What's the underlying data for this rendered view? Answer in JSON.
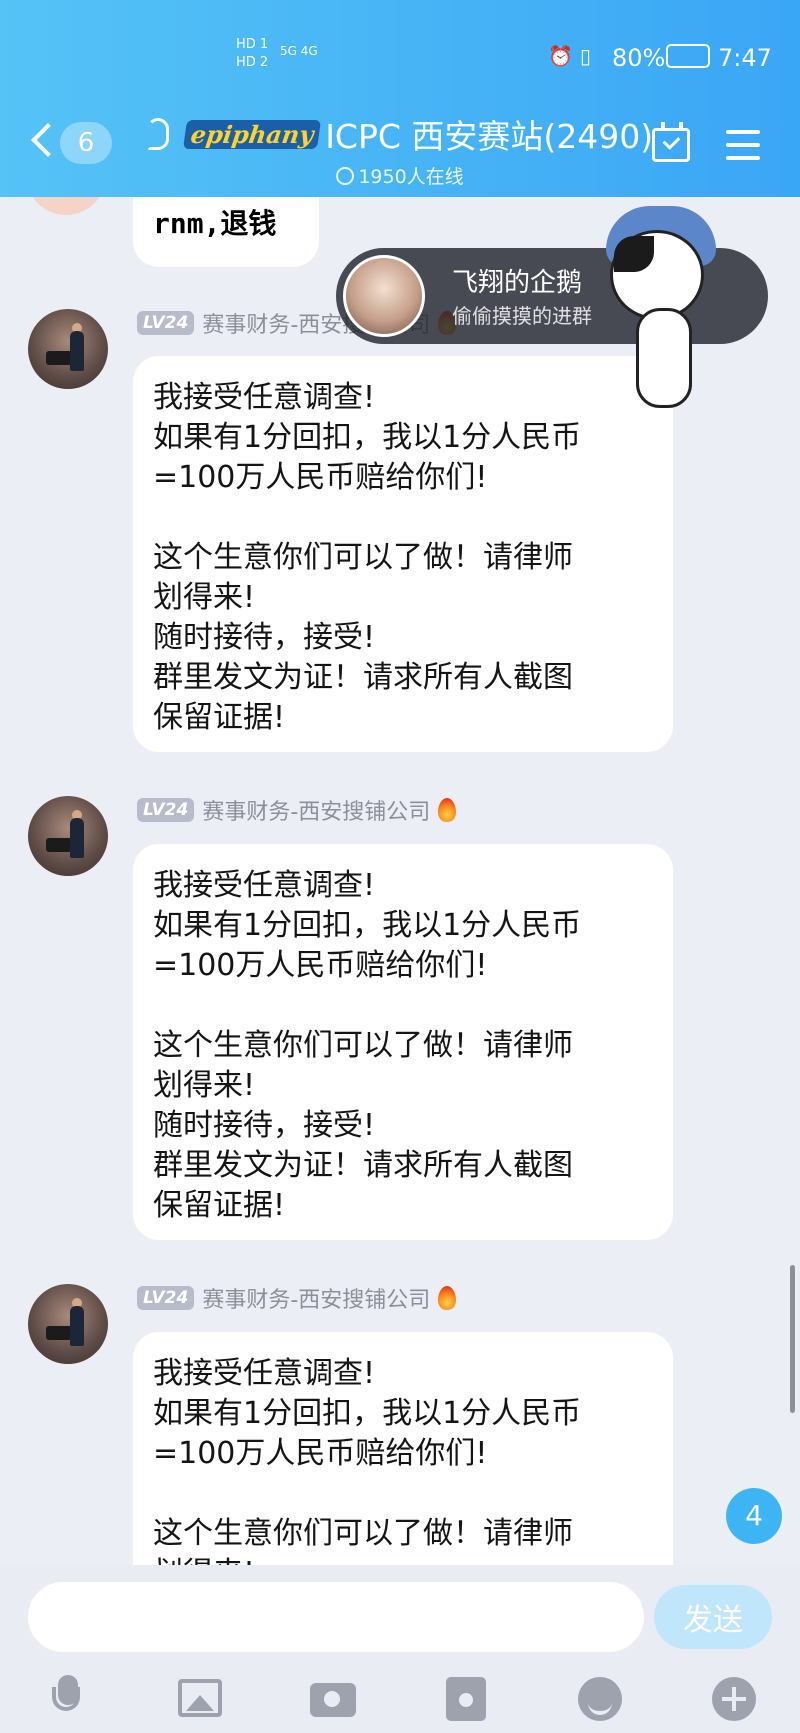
{
  "status_bar": {
    "network_left": "HD 1  HD 2",
    "signal": "5G 4G",
    "battery": "80%",
    "time": "7:47"
  },
  "header": {
    "back_count": "6",
    "brand": "epiphany",
    "title": "ICPC 西安赛站(2490)",
    "online": "1950人在线"
  },
  "join_banner": {
    "name": "飞翔的企鹅",
    "action": "偷偷摸摸的进群"
  },
  "messages": [
    {
      "text": "rnm,退钱"
    },
    {
      "level": "LV24",
      "sender": "赛事财务-西安搜铺公司",
      "text": "我接受任意调查!\n如果有1分回扣，我以1分人民币\n=100万人民币赔给你们!\n\n这个生意你们可以了做！请律师\n划得来!\n随时接待，接受!\n群里发文为证！请求所有人截图\n保留证据!"
    },
    {
      "level": "LV24",
      "sender": "赛事财务-西安搜铺公司",
      "text": "我接受任意调查!\n如果有1分回扣，我以1分人民币\n=100万人民币赔给你们!\n\n这个生意你们可以了做！请律师\n划得来!\n随时接待，接受!\n群里发文为证！请求所有人截图\n保留证据!"
    },
    {
      "level": "LV24",
      "sender": "赛事财务-西安搜铺公司",
      "text": "我接受任意调查!\n如果有1分回扣，我以1分人民币\n=100万人民币赔给你们!\n\n这个生意你们可以了做！请律师\n划得来!"
    }
  ],
  "unread_badge": "4",
  "input": {
    "placeholder": "",
    "send_label": "发送"
  },
  "toolbar": [
    "mic-icon",
    "image-icon",
    "camera-icon",
    "redpacket-icon",
    "emoji-icon",
    "plus-icon"
  ]
}
